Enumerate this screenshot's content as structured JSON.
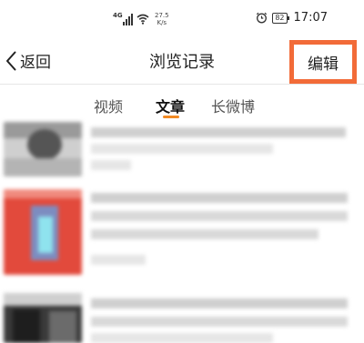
{
  "status_bar": {
    "network_type": "4G",
    "net_speed_value": "27.5",
    "net_speed_unit": "K/s",
    "battery": "82",
    "time": "17:07"
  },
  "nav": {
    "back_label": "返回",
    "title": "浏览记录",
    "edit_label": "编辑"
  },
  "tabs": [
    {
      "label": "视频",
      "active": false
    },
    {
      "label": "文章",
      "active": true
    },
    {
      "label": "长微博",
      "active": false
    }
  ],
  "colors": {
    "accent": "#f28a23",
    "highlight_box": "#f26b38"
  }
}
